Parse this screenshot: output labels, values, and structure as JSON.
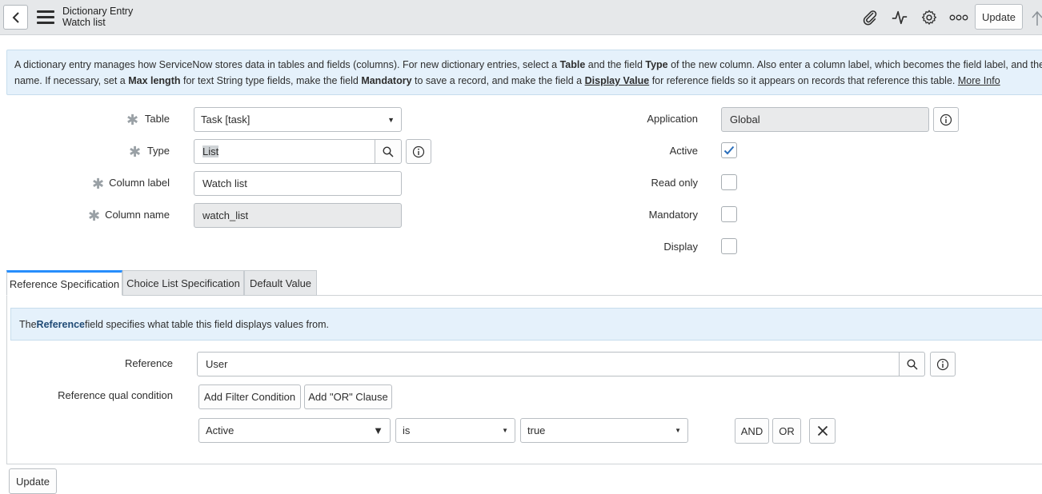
{
  "header": {
    "title": "Dictionary Entry",
    "subtitle": "Watch list",
    "update_label": "Update",
    "icons": [
      "paperclip-icon",
      "activity-icon",
      "gear-icon",
      "more-icon"
    ]
  },
  "info": {
    "line1_a": "A dictionary entry manages how ServiceNow stores data in tables and fields (columns). For new dictionary entries, select a ",
    "line1_table": "Table",
    "line1_b": " and the field ",
    "line1_type": "Type",
    "line1_c": " of the new column. Also enter a column label, which becomes the field label, and the colum",
    "line2_a": "name. If necessary, set a ",
    "line2_max": "Max length",
    "line2_b": " for text String type fields, make the field ",
    "line2_mand": "Mandatory",
    "line2_c": " to save a record, and make the field a ",
    "line2_display": "Display Value",
    "line2_d": " for reference fields so it appears on records that reference this table. ",
    "line2_more": "More Info"
  },
  "form": {
    "table_label": "Table",
    "table_value": "Task [task]",
    "type_label": "Type",
    "type_value": "List",
    "column_label_label": "Column label",
    "column_label_value": "Watch list",
    "column_name_label": "Column name",
    "column_name_value": "watch_list",
    "application_label": "Application",
    "application_value": "Global",
    "active_label": "Active",
    "active_checked": true,
    "readonly_label": "Read only",
    "mandatory_label": "Mandatory",
    "display_label": "Display"
  },
  "tabs": [
    "Reference Specification",
    "Choice List Specification",
    "Default Value"
  ],
  "reference": {
    "info_prefix": "The ",
    "info_bold": "Reference",
    "info_suffix": " field specifies what table this field displays values from.",
    "reference_label": "Reference",
    "reference_value": "User",
    "qual_label": "Reference qual condition",
    "add_filter_label": "Add Filter Condition",
    "add_or_label": "Add \"OR\" Clause",
    "cond_field": "Active",
    "cond_op": "is",
    "cond_value": "true",
    "and_label": "AND",
    "or_label": "OR"
  },
  "footer": {
    "update_label": "Update"
  }
}
